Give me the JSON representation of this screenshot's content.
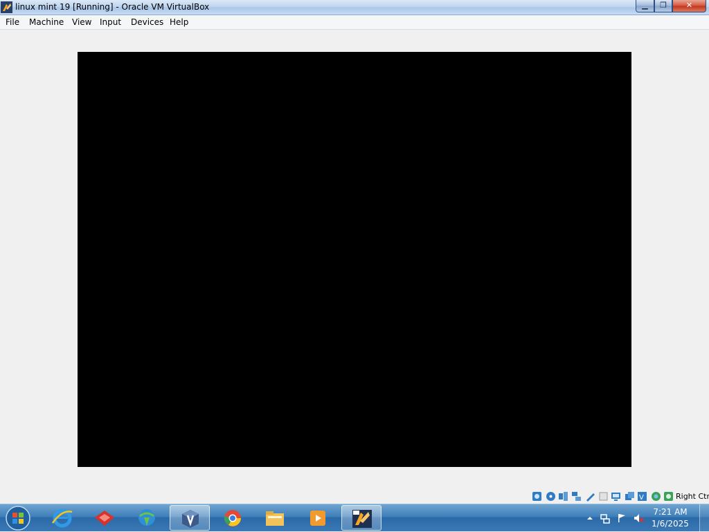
{
  "window": {
    "title": "linux mint 19 [Running] - Oracle VM VirtualBox",
    "minimize_glyph": "▁",
    "maximize_glyph": "❐",
    "close_glyph": "✕"
  },
  "menu": {
    "items": [
      "File",
      "Machine",
      "View",
      "Input",
      "Devices",
      "Help"
    ]
  },
  "vm_display": {
    "background": "#000000"
  },
  "status_bar": {
    "icons": [
      "hard-disk-icon",
      "optical-drive-icon",
      "audio-icon",
      "network-icon",
      "usb-icon",
      "shared-folders-icon",
      "display-icon",
      "video-capture-icon",
      "virtualization-icon",
      "mouse-integration-icon",
      "host-key-icon"
    ],
    "host_key": "Right Ctrl"
  },
  "taskbar": {
    "pinned": [
      "internet-explorer-icon",
      "app-red-icon",
      "internet-download-manager-icon",
      "virtualbox-icon",
      "chrome-icon",
      "file-explorer-icon",
      "media-player-icon",
      "virtualbox-vm-icon"
    ],
    "clock_time": "7:21 AM",
    "clock_date": "1/6/2025"
  },
  "colors": {
    "taskbar": "#3a79b5",
    "vm_background": "#000000",
    "window_background": "#f0f0f0"
  }
}
